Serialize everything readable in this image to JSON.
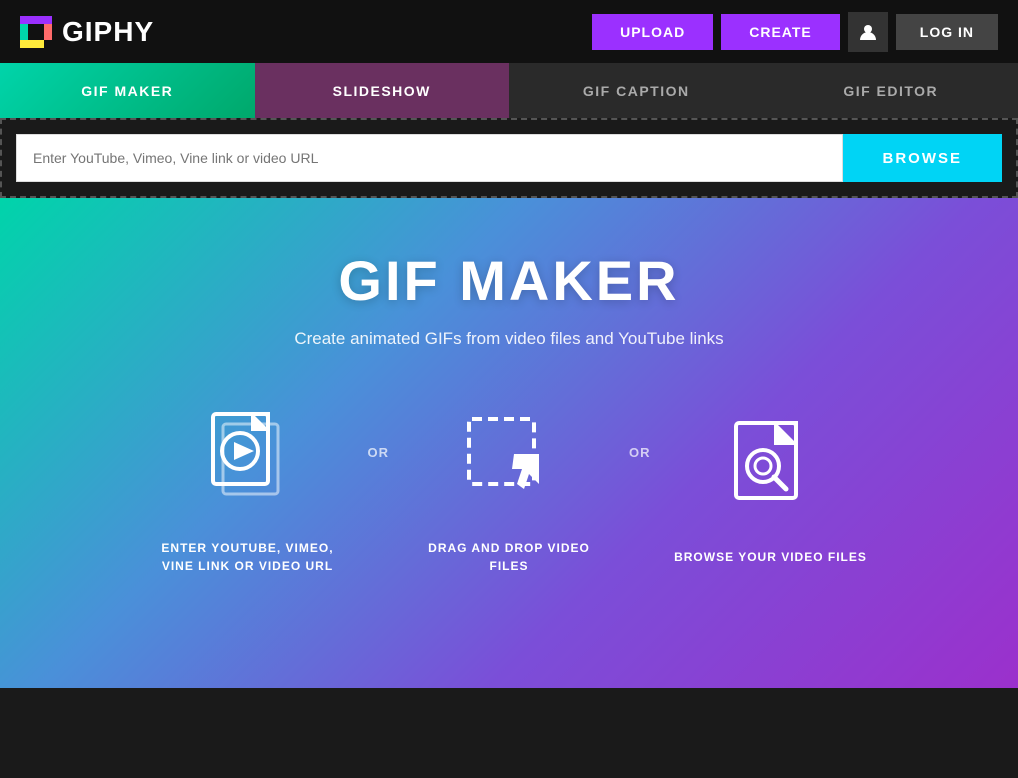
{
  "header": {
    "logo_text": "GIPHY",
    "upload_label": "UPLOAD",
    "create_label": "CREATE",
    "login_label": "LOG IN"
  },
  "tabs": {
    "gif_maker": "GIF MAKER",
    "slideshow": "SLIDESHOW",
    "gif_caption": "GIF CAPTION",
    "gif_editor": "GIF EDITOR"
  },
  "upload": {
    "placeholder": "Enter YouTube, Vimeo, Vine link or video URL",
    "browse_label": "BROWSE"
  },
  "hero": {
    "title": "GIF MAKER",
    "subtitle": "Create animated GIFs from video files and YouTube links",
    "icon1_label": "ENTER YOUTUBE, VIMEO,\nVINE LINK OR VIDEO URL",
    "icon2_label": "DRAG AND DROP VIDEO\nFILES",
    "icon3_label": "BROWSE YOUR VIDEO FILES",
    "or1": "OR",
    "or2": "OR"
  }
}
